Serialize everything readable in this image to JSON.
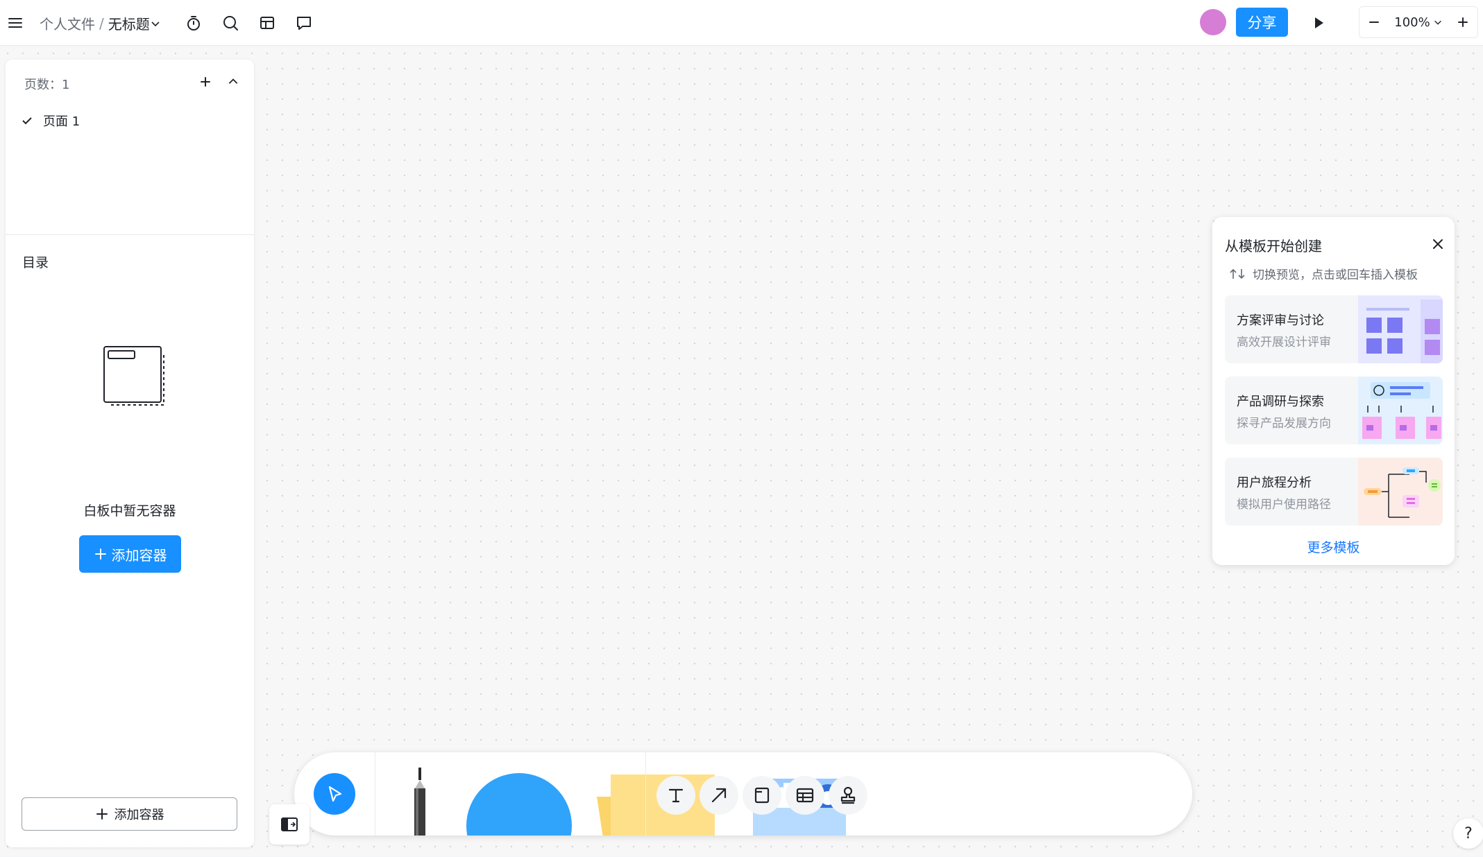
{
  "header": {
    "breadcrumb_root": "个人文件",
    "breadcrumb_sep": "/",
    "doc_title": "无标题",
    "share_label": "分享",
    "zoom_level": "100%"
  },
  "left_panel": {
    "pages_label": "页数：1",
    "pages": [
      {
        "label": "页面 1",
        "checked": true
      }
    ],
    "toc_title": "目录",
    "empty_text": "白板中暂无容器",
    "add_container_label": "添加容器",
    "add_container_bottom_label": "添加容器"
  },
  "template_panel": {
    "title": "从模板开始创建",
    "hint": "切换预览，点击或回车插入模板",
    "templates": [
      {
        "name": "方案评审与讨论",
        "desc": "高效开展设计评审"
      },
      {
        "name": "产品调研与探索",
        "desc": "探寻产品发展方向"
      },
      {
        "name": "用户旅程分析",
        "desc": "模拟用户使用路径"
      }
    ],
    "more_label": "更多模板"
  },
  "toolbar": {
    "tools": [
      "select-icon",
      "pen-icon",
      "shape-icon",
      "sticky-note-icon",
      "media-icon",
      "text-icon",
      "arrow-icon",
      "frame-icon",
      "table-icon",
      "stamp-icon"
    ]
  },
  "colors": {
    "primary": "#1890ff",
    "avatar": "#d67dd6",
    "shape": "#30a3fb",
    "sticky": "#ffe08a",
    "link": "#1677ff"
  },
  "help_label": "?"
}
